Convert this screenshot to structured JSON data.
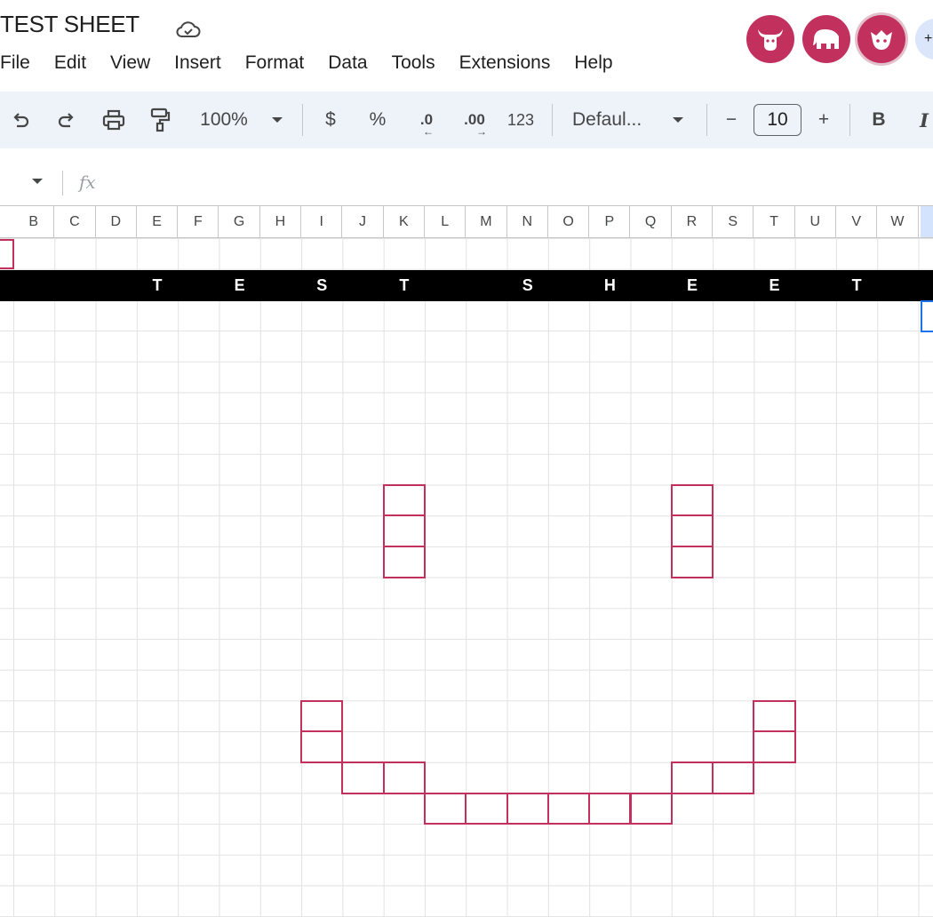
{
  "doc": {
    "title": "TEST SHEET"
  },
  "menu": [
    "File",
    "Edit",
    "View",
    "Insert",
    "Format",
    "Data",
    "Tools",
    "Extensions",
    "Help"
  ],
  "avatars": [
    "bull-avatar",
    "elephant-avatar",
    "creature-avatar"
  ],
  "avatars_more_label": "+",
  "toolbar": {
    "zoom": "100%",
    "currency": "$",
    "percent": "%",
    "decrease_decimal": ".0",
    "increase_decimal": ".00",
    "number_format": "123",
    "font": "Defaul...",
    "font_size": "10",
    "minus": "−",
    "plus": "+",
    "bold": "B",
    "italic": "I"
  },
  "formula_bar": {
    "fx": "fx"
  },
  "columns": [
    "B",
    "C",
    "D",
    "E",
    "F",
    "G",
    "H",
    "I",
    "J",
    "K",
    "L",
    "M",
    "N",
    "O",
    "P",
    "Q",
    "R",
    "S",
    "T",
    "U",
    "V",
    "W"
  ],
  "banner": [
    "T",
    "E",
    "S",
    "T",
    "S",
    "H",
    "E",
    "E",
    "T"
  ],
  "colors": {
    "accent": "#c2305e",
    "selection": "#1a73e8",
    "toolbar_bg": "#eef2f9"
  }
}
